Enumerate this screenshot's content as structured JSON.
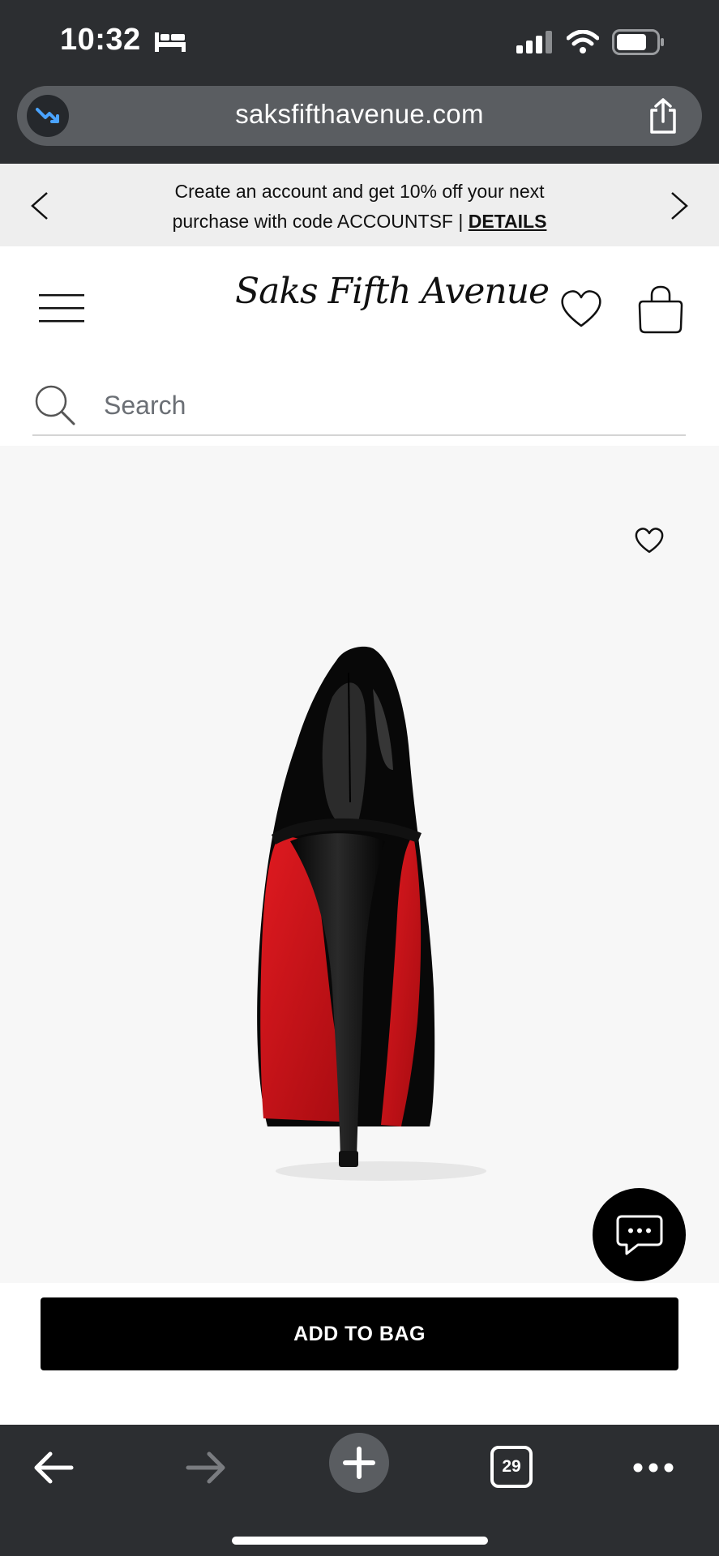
{
  "status_bar": {
    "time": "10:32",
    "icons": [
      "bed-icon",
      "signal-icon",
      "wifi-icon",
      "battery-icon"
    ]
  },
  "browser": {
    "url": "saksfifthavenue.com",
    "icons": [
      "tracking-shield-icon",
      "share-icon"
    ]
  },
  "promo": {
    "line1": "Create an account and get 10% off your next",
    "line2_prefix": "purchase with code ACCOUNTSF | ",
    "details_link": "DETAILS"
  },
  "header": {
    "logo_text": "Saks Fifth Avenue",
    "icons": [
      "menu-icon",
      "heart-icon",
      "shopping-bag-icon"
    ]
  },
  "search": {
    "placeholder": "Search"
  },
  "product": {
    "image_alt": "black patent leather pump with red sole",
    "icons": [
      "favorite-heart-icon",
      "chat-icon"
    ]
  },
  "actions": {
    "add_to_bag_label": "ADD TO BAG"
  },
  "toolbar": {
    "tab_count": "29",
    "icons": [
      "back-arrow-icon",
      "forward-arrow-icon",
      "new-tab-plus-icon",
      "tabs-icon",
      "more-icon"
    ]
  },
  "colors": {
    "chrome_dark": "#2c2e31",
    "url_bar": "#5a5d61",
    "promo_bg": "#eeeeee",
    "product_bg": "#f7f7f7",
    "sole_red": "#d0131a",
    "button_black": "#000000"
  }
}
